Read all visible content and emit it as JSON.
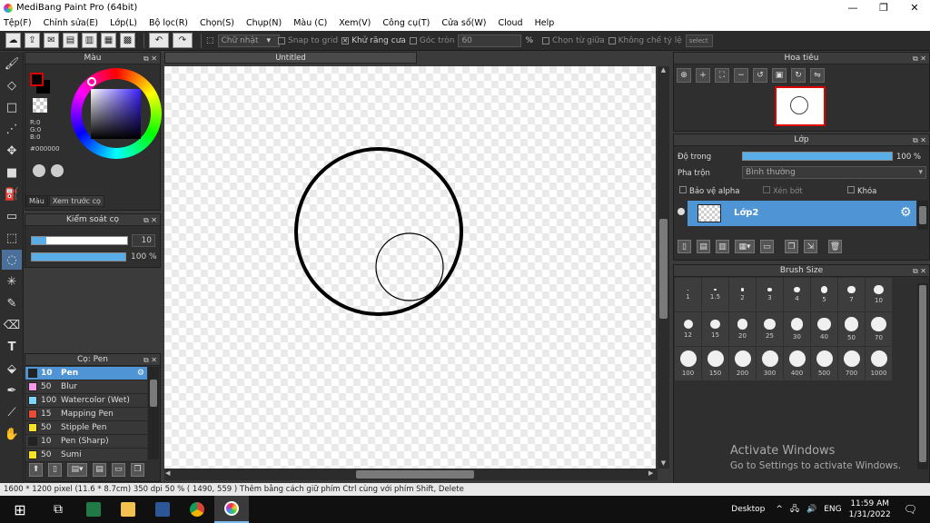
{
  "window": {
    "title": "MediBang Paint Pro (64bit)",
    "minimize": "—",
    "maximize": "❐",
    "close": "✕"
  },
  "menu": [
    "Tệp(F)",
    "Chỉnh sửa(E)",
    "Lớp(L)",
    "Bộ lọc(R)",
    "Chọn(S)",
    "Chụp(N)",
    "Màu (C)",
    "Xem(V)",
    "Công cụ(T)",
    "Cửa số(W)",
    "Cloud",
    "Help"
  ],
  "options": {
    "shape": "Chữ nhật",
    "snap": "Snap to grid",
    "antialias": "Khử răng cưa",
    "round": "Góc tròn",
    "round_value": "60",
    "percent": "%",
    "center": "Chọn từ giữa",
    "aspect": "Không chế tỷ lệ",
    "select_btn": "select"
  },
  "color_panel": {
    "title": "Màu",
    "r": "R:0",
    "g": "G:0",
    "b": "B:0",
    "hex": "#000000",
    "tab_color": "Màu",
    "tab_preview": "Xem trước cọ"
  },
  "brush_control": {
    "title": "Kiểm soát cọ",
    "size": "10",
    "opacity": "100 %",
    "size_fraction": 0.15,
    "opacity_fraction": 1.0
  },
  "brush_list": {
    "title": "Cọ: Pen",
    "items": [
      {
        "num": "10",
        "name": "Pen",
        "color": "#222222",
        "selected": true
      },
      {
        "num": "50",
        "name": "Blur",
        "color": "#f59ae8",
        "selected": false
      },
      {
        "num": "100",
        "name": "Watercolor (Wet)",
        "color": "#7fd4f5",
        "selected": false
      },
      {
        "num": "15",
        "name": "Mapping Pen",
        "color": "#e84c3d",
        "selected": false
      },
      {
        "num": "50",
        "name": "Stipple Pen",
        "color": "#f5e02a",
        "selected": false
      },
      {
        "num": "10",
        "name": "Pen (Sharp)",
        "color": "#222222",
        "selected": false
      },
      {
        "num": "50",
        "name": "Sumi",
        "color": "#f5e02a",
        "selected": false
      }
    ]
  },
  "document": {
    "tab": "Untitled"
  },
  "navigator": {
    "title": "Hoa tiêu"
  },
  "layer_panel": {
    "title": "Lớp",
    "opacity_label": "Độ trong",
    "opacity_value": "100 %",
    "blend_label": "Pha trộn",
    "blend_value": "Bình thường",
    "protect_alpha": "Bảo vệ alpha",
    "clip": "Xén bớt",
    "lock": "Khóa",
    "layer_name": "Lớp2"
  },
  "brush_size": {
    "title": "Brush Size",
    "sizes": [
      "1",
      "1.5",
      "2",
      "3",
      "4",
      "5",
      "7",
      "10",
      "12",
      "15",
      "20",
      "25",
      "30",
      "40",
      "50",
      "70",
      "100",
      "150",
      "200",
      "300",
      "400",
      "500",
      "700",
      "1000"
    ]
  },
  "watermark": {
    "line1": "Activate Windows",
    "line2": "Go to Settings to activate Windows."
  },
  "status": "1600 * 1200 pixel   (11.6 * 8.7cm)   350 dpi   50 %   ( 1490, 559 )   Thêm bằng cách giữ phím Ctrl cùng với phím Shift, Delete",
  "taskbar": {
    "desktop": "Desktop",
    "lang": "ENG",
    "time": "11:59 AM",
    "date": "1/31/2022"
  }
}
